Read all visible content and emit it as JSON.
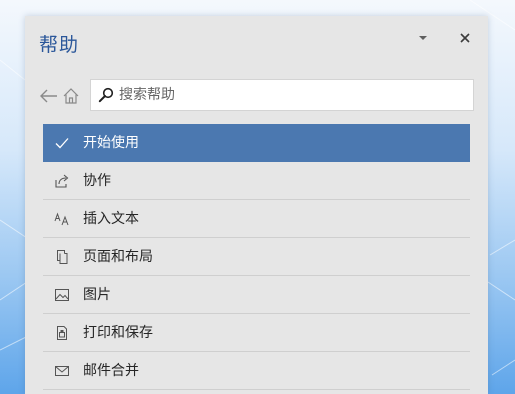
{
  "pane": {
    "title": "帮助",
    "options_icon": "chevron-down-icon",
    "close_icon": "close-icon"
  },
  "navigation": {
    "back_icon": "arrow-left-icon",
    "home_icon": "home-icon"
  },
  "search": {
    "placeholder": "搜索帮助",
    "value": "",
    "icon": "search-icon"
  },
  "topics": [
    {
      "label": "开始使用",
      "icon": "checkmark-icon",
      "selected": true
    },
    {
      "label": "协作",
      "icon": "share-icon",
      "selected": false
    },
    {
      "label": "插入文本",
      "icon": "text-size-icon",
      "selected": false
    },
    {
      "label": "页面和布局",
      "icon": "pages-icon",
      "selected": false
    },
    {
      "label": "图片",
      "icon": "picture-icon",
      "selected": false
    },
    {
      "label": "打印和保存",
      "icon": "print-save-icon",
      "selected": false
    },
    {
      "label": "邮件合并",
      "icon": "envelope-icon",
      "selected": false
    }
  ],
  "colors": {
    "selected_background": "#4b78b0",
    "title_text": "#2b579a",
    "panel_background": "#e6e6e6"
  }
}
